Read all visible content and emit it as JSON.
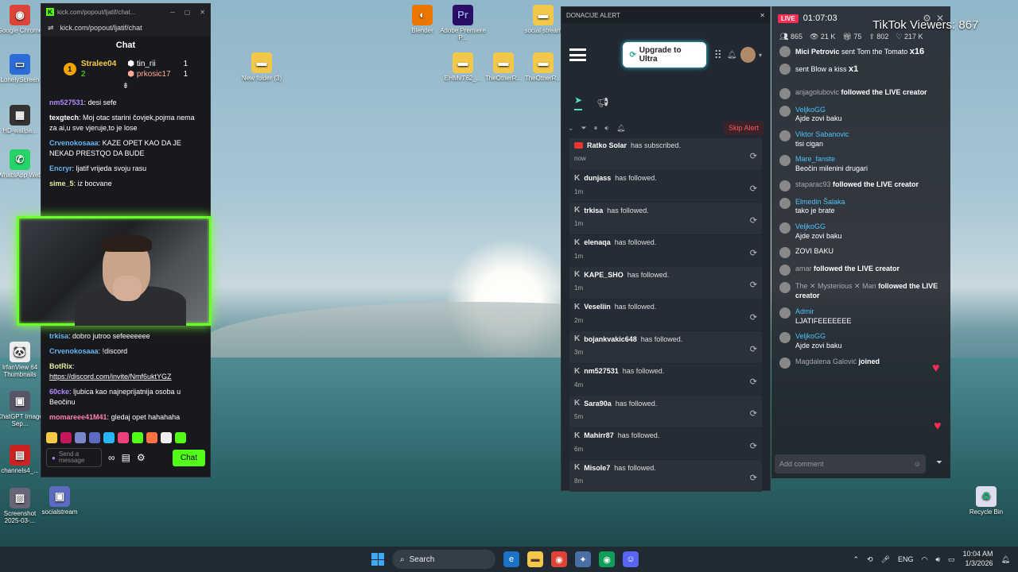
{
  "desktop": {
    "icons_left": [
      {
        "label": "Google Chrome",
        "glyph": "◉",
        "color": "#db4437"
      },
      {
        "label": "LonelyScreen",
        "glyph": "▭",
        "color": "#2b6cd6"
      },
      {
        "label": "HD-wallpa...",
        "glyph": "▦",
        "color": "#333"
      },
      {
        "label": "WhatsApp Web",
        "glyph": "✆",
        "color": "#25d366"
      },
      {
        "label": "IrfanView 64 Thumbnails",
        "glyph": "🐼",
        "color": "#eee"
      },
      {
        "label": "ChatGPT Image Sep...",
        "glyph": "▣",
        "color": "#556"
      },
      {
        "label": "channels4_...",
        "glyph": "▤",
        "color": "#c22"
      },
      {
        "label": "Screenshot 2025-03-...",
        "glyph": "▨",
        "color": "#667"
      }
    ],
    "icons_top": [
      {
        "label": "Blender",
        "glyph": "◐",
        "color": "#ea7600"
      },
      {
        "label": "Adobe Premiere P...",
        "glyph": "Pr",
        "color": "#2a0e68"
      },
      {
        "label": "social stream",
        "glyph": "▬",
        "color": "#f3c84a"
      },
      {
        "label": "New folder (3)",
        "glyph": "▬",
        "color": "#f3c84a"
      },
      {
        "label": "EHMvT62_...",
        "glyph": "▬",
        "color": "#f3c84a"
      },
      {
        "label": "TheOtherR...",
        "glyph": "▬",
        "color": "#f3c84a"
      },
      {
        "label": "TheOtherR...",
        "glyph": "▬",
        "color": "#f3c84a"
      }
    ],
    "socialstream_label": "socialstream",
    "recycle_label": "Recycle Bin"
  },
  "kick": {
    "window_title": "kick.com/popout/ljatif/chat...",
    "url": "kick.com/popout/ljatif/chat",
    "header": "Chat",
    "leaderboard": {
      "rank": "1",
      "first": {
        "name": "Stralee04",
        "count": "2"
      },
      "second": {
        "name": "tin_rii",
        "count": "1"
      },
      "third": {
        "name": "prkosic17",
        "count": "1"
      }
    },
    "messages": [
      {
        "user": "nm527531",
        "color": "#b388ff",
        "text": "desi sefe"
      },
      {
        "user": "texgtech",
        "color": "#ffffff",
        "text": "Moj otac starini čovjek,pojma nema za ai,u sve vjeruje,to je lose"
      },
      {
        "user": "Crvenokosaaa",
        "color": "#64b5f6",
        "text": "KAZE OPET KAO DA JE NEKAD PRESTQO DA BUDE"
      },
      {
        "user": "Encryr",
        "color": "#64b5f6",
        "text": "ljatif vrijeda svoju rasu"
      },
      {
        "user": "sime_5",
        "color": "#e6ee9c",
        "text": "iz bocvane"
      }
    ],
    "messages_after": [
      {
        "user": "trkisa",
        "color": "#64b5f6",
        "text": "dobro jutroo sefeeeeeee"
      },
      {
        "user": "Crvenokosaaa",
        "color": "#64b5f6",
        "text": "!discord"
      },
      {
        "user": "BotRix",
        "color": "#e6ee9c",
        "text": "",
        "link": "https://discord.com/invite/Nmf6uktYGZ"
      },
      {
        "user": "60cke",
        "color": "#b388ff",
        "text": "ljubica kao najneprijatnija osoba u Beočinu"
      },
      {
        "user": "momareee41M41",
        "color": "#ff80ab",
        "text": "gledaj opet hahahaha"
      }
    ],
    "send_placeholder": "Send a message",
    "chat_button": "Chat"
  },
  "dona": {
    "window_title": "DONACIJE ALERT",
    "upgrade_label": "Upgrade to Ultra",
    "skip_label": "Skip Alert",
    "alerts": [
      {
        "icon": "youtube",
        "name": "Ratko Solar",
        "action": "has subscribed.",
        "time": "now"
      },
      {
        "icon": "kick",
        "name": "dunjass",
        "action": "has followed.",
        "time": "1m"
      },
      {
        "icon": "kick",
        "name": "trkisa",
        "action": "has followed.",
        "time": "1m"
      },
      {
        "icon": "kick",
        "name": "elenaqa",
        "action": "has followed.",
        "time": "1m"
      },
      {
        "icon": "kick",
        "name": "KAPE_SHO",
        "action": "has followed.",
        "time": "1m"
      },
      {
        "icon": "kick",
        "name": "Veseliin",
        "action": "has followed.",
        "time": "2m"
      },
      {
        "icon": "kick",
        "name": "bojankvakic648",
        "action": "has followed.",
        "time": "3m"
      },
      {
        "icon": "kick",
        "name": "nm527531",
        "action": "has followed.",
        "time": "4m"
      },
      {
        "icon": "kick",
        "name": "Sara90a",
        "action": "has followed.",
        "time": "5m"
      },
      {
        "icon": "kick",
        "name": "Mahirr87",
        "action": "has followed.",
        "time": "6m"
      },
      {
        "icon": "kick",
        "name": "Misole7",
        "action": "has followed.",
        "time": "8m"
      }
    ]
  },
  "tiktok": {
    "live_badge": "LIVE",
    "timer": "01:07:03",
    "viewers_label": "TikTok Viewers: 867",
    "stats": [
      "865",
      "21 K",
      "75",
      "802",
      "217 K"
    ],
    "gifts": [
      {
        "user": "Mici Petrovic",
        "text": "sent Tom the Tomato",
        "count": "x16"
      },
      {
        "user": "",
        "text": "sent Blow a kiss",
        "count": "x1"
      }
    ],
    "feed": [
      {
        "user": "anjagolubovic",
        "text": "followed the LIVE creator",
        "kind": "follow"
      },
      {
        "user": "VeljkoGG",
        "text": "Ajde zovi baku",
        "kind": "chat"
      },
      {
        "user": "Viktor Sabanovic",
        "text": "tisi cigan",
        "kind": "chat"
      },
      {
        "user": "Mare_fanste",
        "text": "Beočin milenini drugari",
        "kind": "chat"
      },
      {
        "user": "staparac93",
        "text": "followed the LIVE creator",
        "kind": "follow"
      },
      {
        "user": "Elmedin Šalaka",
        "text": "tako je brate",
        "kind": "chat"
      },
      {
        "user": "VeljkoGG",
        "text": "Ajde zovi baku",
        "kind": "chat"
      },
      {
        "user": "",
        "text": "ZOVI BAKU",
        "kind": "chat"
      },
      {
        "user": "amar",
        "text": "followed the LIVE creator",
        "kind": "follow"
      },
      {
        "user": "The ✕ Mysterious ✕ Man",
        "text": "followed the LIVE creator",
        "kind": "follow"
      },
      {
        "user": "Admir",
        "text": "LJATIFEEEEEEE",
        "kind": "chat"
      },
      {
        "user": "VeljkoGG",
        "text": "Ajde zovi baku",
        "kind": "chat"
      },
      {
        "user": "Magdalena Galović",
        "text": "joined",
        "kind": "follow"
      }
    ],
    "comment_placeholder": "Add comment"
  },
  "taskbar": {
    "search_label": "Search",
    "lang": "ENG",
    "time": "10:04 AM",
    "date": "1/3/2026"
  }
}
